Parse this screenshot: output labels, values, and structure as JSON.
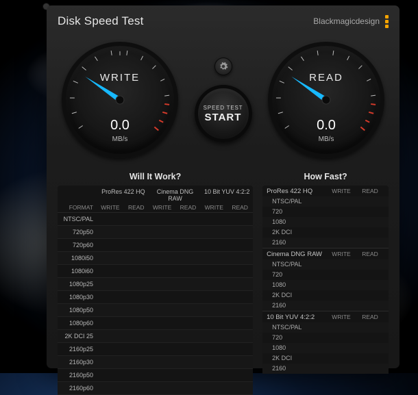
{
  "header": {
    "title": "Disk Speed Test",
    "brand": "Blackmagicdesign"
  },
  "gauges": {
    "write": {
      "label": "WRITE",
      "value": "0.0",
      "unit": "MB/s"
    },
    "read": {
      "label": "READ",
      "value": "0.0",
      "unit": "MB/s"
    }
  },
  "center": {
    "start_line1": "SPEED TEST",
    "start_line2": "START"
  },
  "columns": {
    "write": "WRITE",
    "read": "READ",
    "format": "FORMAT"
  },
  "will_it_work": {
    "title": "Will It Work?",
    "groups": [
      "ProRes 422 HQ",
      "Cinema DNG RAW",
      "10 Bit YUV 4:2:2"
    ],
    "formats": [
      "NTSC/PAL",
      "720p50",
      "720p60",
      "1080i50",
      "1080i60",
      "1080p25",
      "1080p30",
      "1080p50",
      "1080p60",
      "2K DCI 25",
      "2160p25",
      "2160p30",
      "2160p50",
      "2160p60"
    ]
  },
  "how_fast": {
    "title": "How Fast?",
    "groups": [
      {
        "name": "ProRes 422 HQ",
        "formats": [
          "NTSC/PAL",
          "720",
          "1080",
          "2K DCI",
          "2160"
        ]
      },
      {
        "name": "Cinema DNG RAW",
        "formats": [
          "NTSC/PAL",
          "720",
          "1080",
          "2K DCI",
          "2160"
        ]
      },
      {
        "name": "10 Bit YUV 4:2:2",
        "formats": [
          "NTSC/PAL",
          "720",
          "1080",
          "2K DCI",
          "2160"
        ]
      }
    ]
  }
}
